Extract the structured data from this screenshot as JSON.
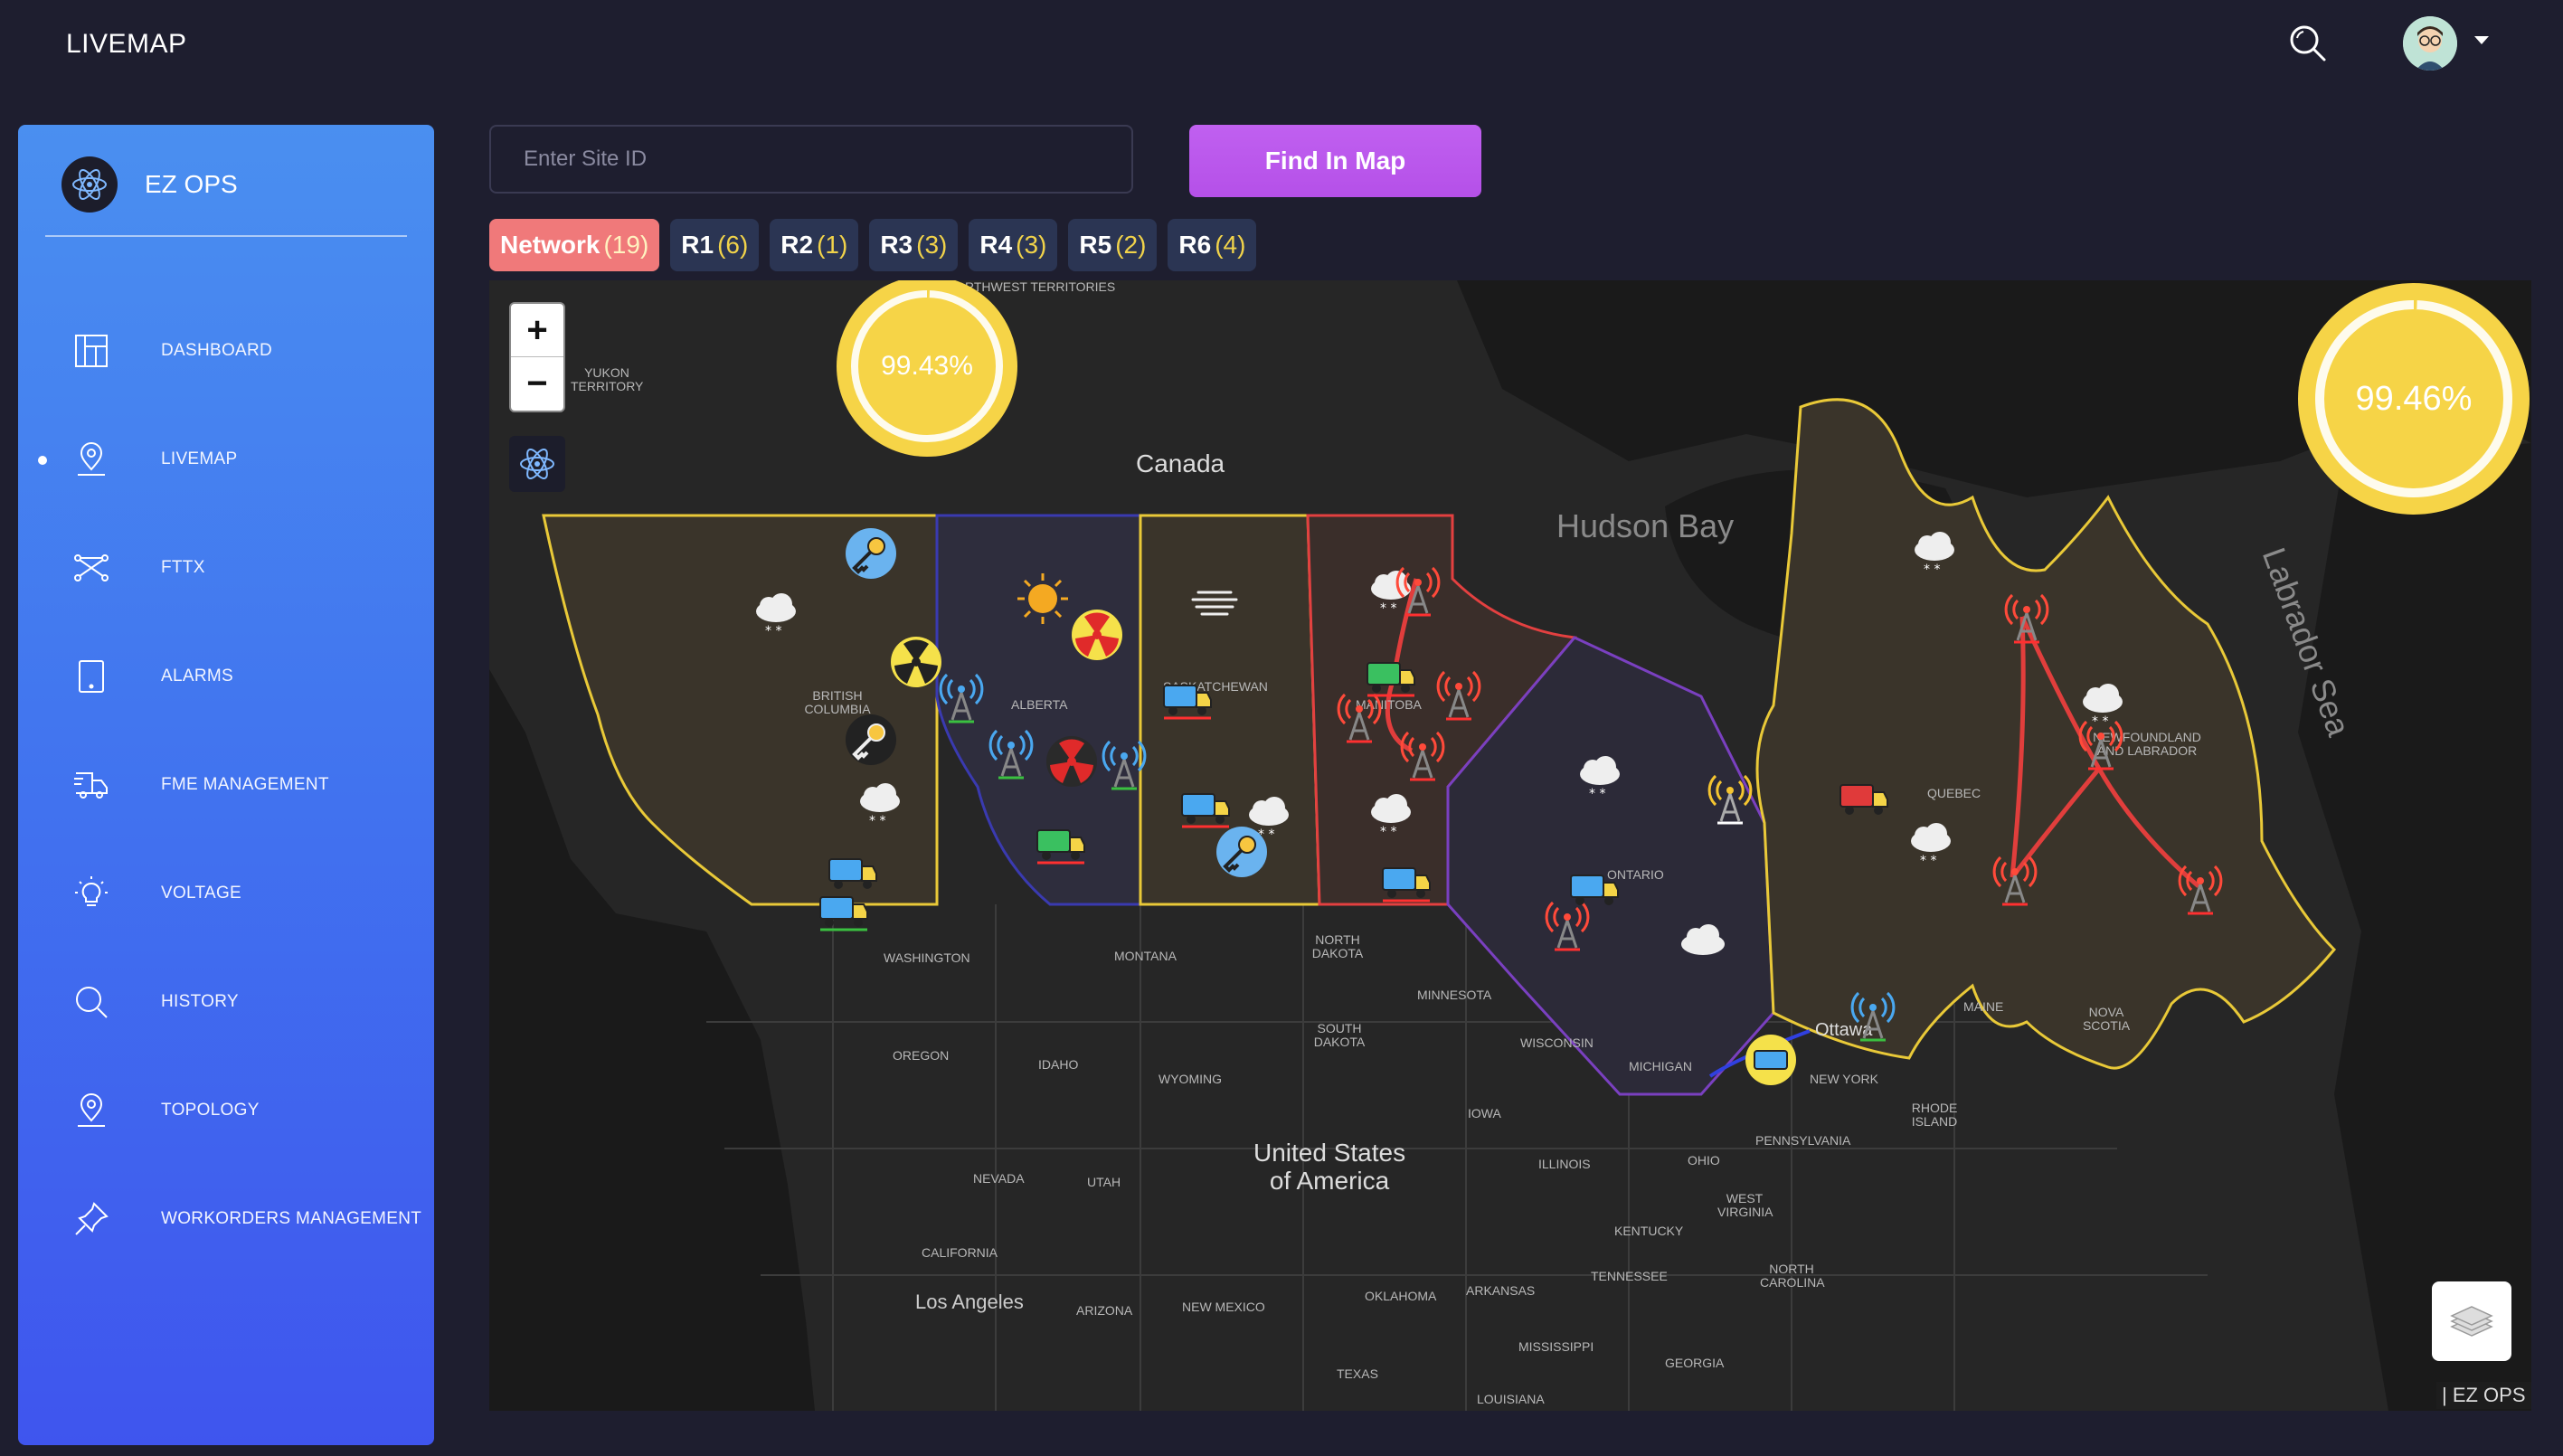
{
  "header": {
    "title": "LIVEMAP"
  },
  "sidebar": {
    "brand": "EZ OPS",
    "items": [
      {
        "label": "DASHBOARD",
        "icon": "dashboard-icon"
      },
      {
        "label": "LIVEMAP",
        "icon": "map-pin-icon",
        "active": true
      },
      {
        "label": "FTTX",
        "icon": "network-icon"
      },
      {
        "label": "ALARMS",
        "icon": "tablet-icon"
      },
      {
        "label": "FME MANAGEMENT",
        "icon": "truck-icon"
      },
      {
        "label": "VOLTAGE",
        "icon": "bulb-icon"
      },
      {
        "label": "HISTORY",
        "icon": "search-icon"
      },
      {
        "label": "TOPOLOGY",
        "icon": "map-pin-icon"
      },
      {
        "label": "WORKORDERS MANAGEMENT",
        "icon": "pin-icon"
      }
    ]
  },
  "search": {
    "placeholder": "Enter Site ID",
    "value": "",
    "button": "Find In Map"
  },
  "tabs": [
    {
      "label": "Network",
      "count": "(19)",
      "active": true
    },
    {
      "label": "R1",
      "count": "(6)"
    },
    {
      "label": "R2",
      "count": "(1)"
    },
    {
      "label": "R3",
      "count": "(3)"
    },
    {
      "label": "R4",
      "count": "(3)"
    },
    {
      "label": "R5",
      "count": "(2)"
    },
    {
      "label": "R6",
      "count": "(4)"
    }
  ],
  "map": {
    "zoom_in": "+",
    "zoom_out": "−",
    "gauges": [
      {
        "value": "99.43%",
        "level": 0.9943
      },
      {
        "value": "99.46%",
        "level": 0.9946
      }
    ],
    "attribution": "| EZ OPS",
    "labels": {
      "canada": "Canada",
      "usa_1": "United States",
      "usa_2": "of America",
      "hudson": "Hudson Bay",
      "labrador_sea": "Labrador Sea",
      "yukon": "YUKON TERRITORY",
      "nwt": "NORTHWEST TERRITORIES",
      "bc": "BRITISH COLUMBIA",
      "alberta": "ALBERTA",
      "sask": "SASKATCHEWAN",
      "manitoba": "MANITOBA",
      "ontario": "ONTARIO",
      "quebec": "QUEBEC",
      "nfl": "NEWFOUNDLAND AND LABRADOR",
      "ottawa": "Ottawa",
      "washington": "WASHINGTON",
      "montana": "MONTANA",
      "north_dakota": "NORTH DAKOTA",
      "minnesota": "MINNESOTA",
      "south_dakota": "SOUTH DAKOTA",
      "oregon": "OREGON",
      "idaho": "IDAHO",
      "wyoming": "WYOMING",
      "wisconsin": "WISCONSIN",
      "michigan": "MICHIGAN",
      "new_york": "NEW YORK",
      "maine": "MAINE",
      "nova_scotia": "NOVA SCOTIA",
      "iowa": "IOWA",
      "pennsylvania": "PENNSYLVANIA",
      "rhode_island": "RHODE ISLAND",
      "nevada": "NEVADA",
      "utah": "UTAH",
      "illinois": "ILLINOIS",
      "ohio": "OHIO",
      "west_virginia": "WEST VIRGINIA",
      "kentucky": "KENTUCKY",
      "california": "CALIFORNIA",
      "los_angeles": "Los Angeles",
      "arizona": "ARIZONA",
      "new_mexico": "NEW MEXICO",
      "oklahoma": "OKLAHOMA",
      "arkansas": "ARKANSAS",
      "tennessee": "TENNESSEE",
      "north_carolina": "NORTH CAROLINA",
      "mississippi": "MISSISSIPPI",
      "georgia": "GEORGIA",
      "texas": "TEXAS",
      "louisiana": "LOUISIANA"
    }
  },
  "colors": {
    "sidebar_top": "#4a8ff0",
    "sidebar_bottom": "#3f55ee",
    "tab_active": "#f0797a",
    "button": "#b550e8",
    "gauge": "#f6d447",
    "region_yellow": "#e9c938",
    "region_red": "#e34040",
    "region_purple": "#a040c0"
  }
}
